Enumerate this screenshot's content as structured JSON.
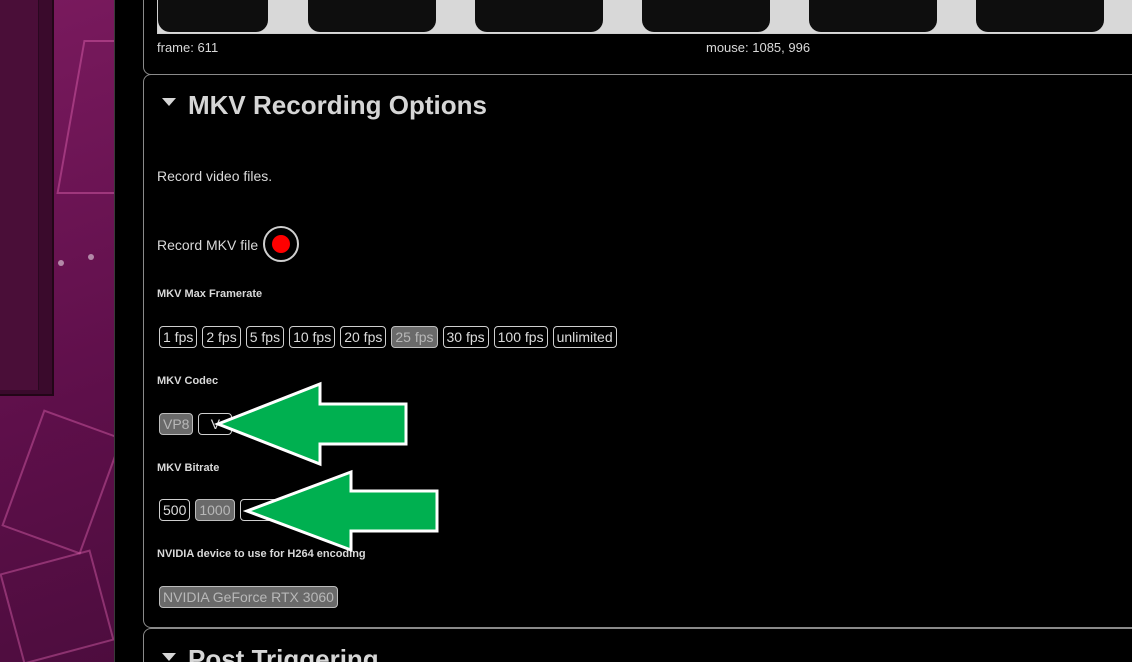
{
  "status": {
    "frame_text": "frame: 611",
    "mouse_text": "mouse: 1085, 996"
  },
  "mkv_section": {
    "title": "MKV Recording Options",
    "description": "Record video files.",
    "record_label": "Record MKV file",
    "record_state": "recording",
    "framerate": {
      "label": "MKV Max Framerate",
      "options": [
        "1 fps",
        "2 fps",
        "5 fps",
        "10 fps",
        "20 fps",
        "25 fps",
        "30 fps",
        "100 fps",
        "unlimited"
      ],
      "selected": "25 fps"
    },
    "codec": {
      "label": "MKV Codec",
      "options": [
        "VP8",
        "V"
      ],
      "selected": "VP8"
    },
    "bitrate": {
      "label": "MKV Bitrate",
      "options": [
        "500",
        "1000",
        "000"
      ],
      "selected": "1000"
    },
    "nvidia": {
      "label": "NVIDIA device to use for H264 encoding",
      "options": [
        "NVIDIA GeForce RTX 3060"
      ],
      "selected": "NVIDIA GeForce RTX 3060"
    }
  },
  "next_section": {
    "title": "Post Triggering"
  },
  "colors": {
    "record_red": "#ff0000",
    "arrow_green": "#00b050",
    "selected_bg": "#6a6a6a"
  },
  "icons": {
    "expand": "triangle-down-icon",
    "record": "record-dot-icon",
    "annotation": "left-arrow-icon"
  }
}
